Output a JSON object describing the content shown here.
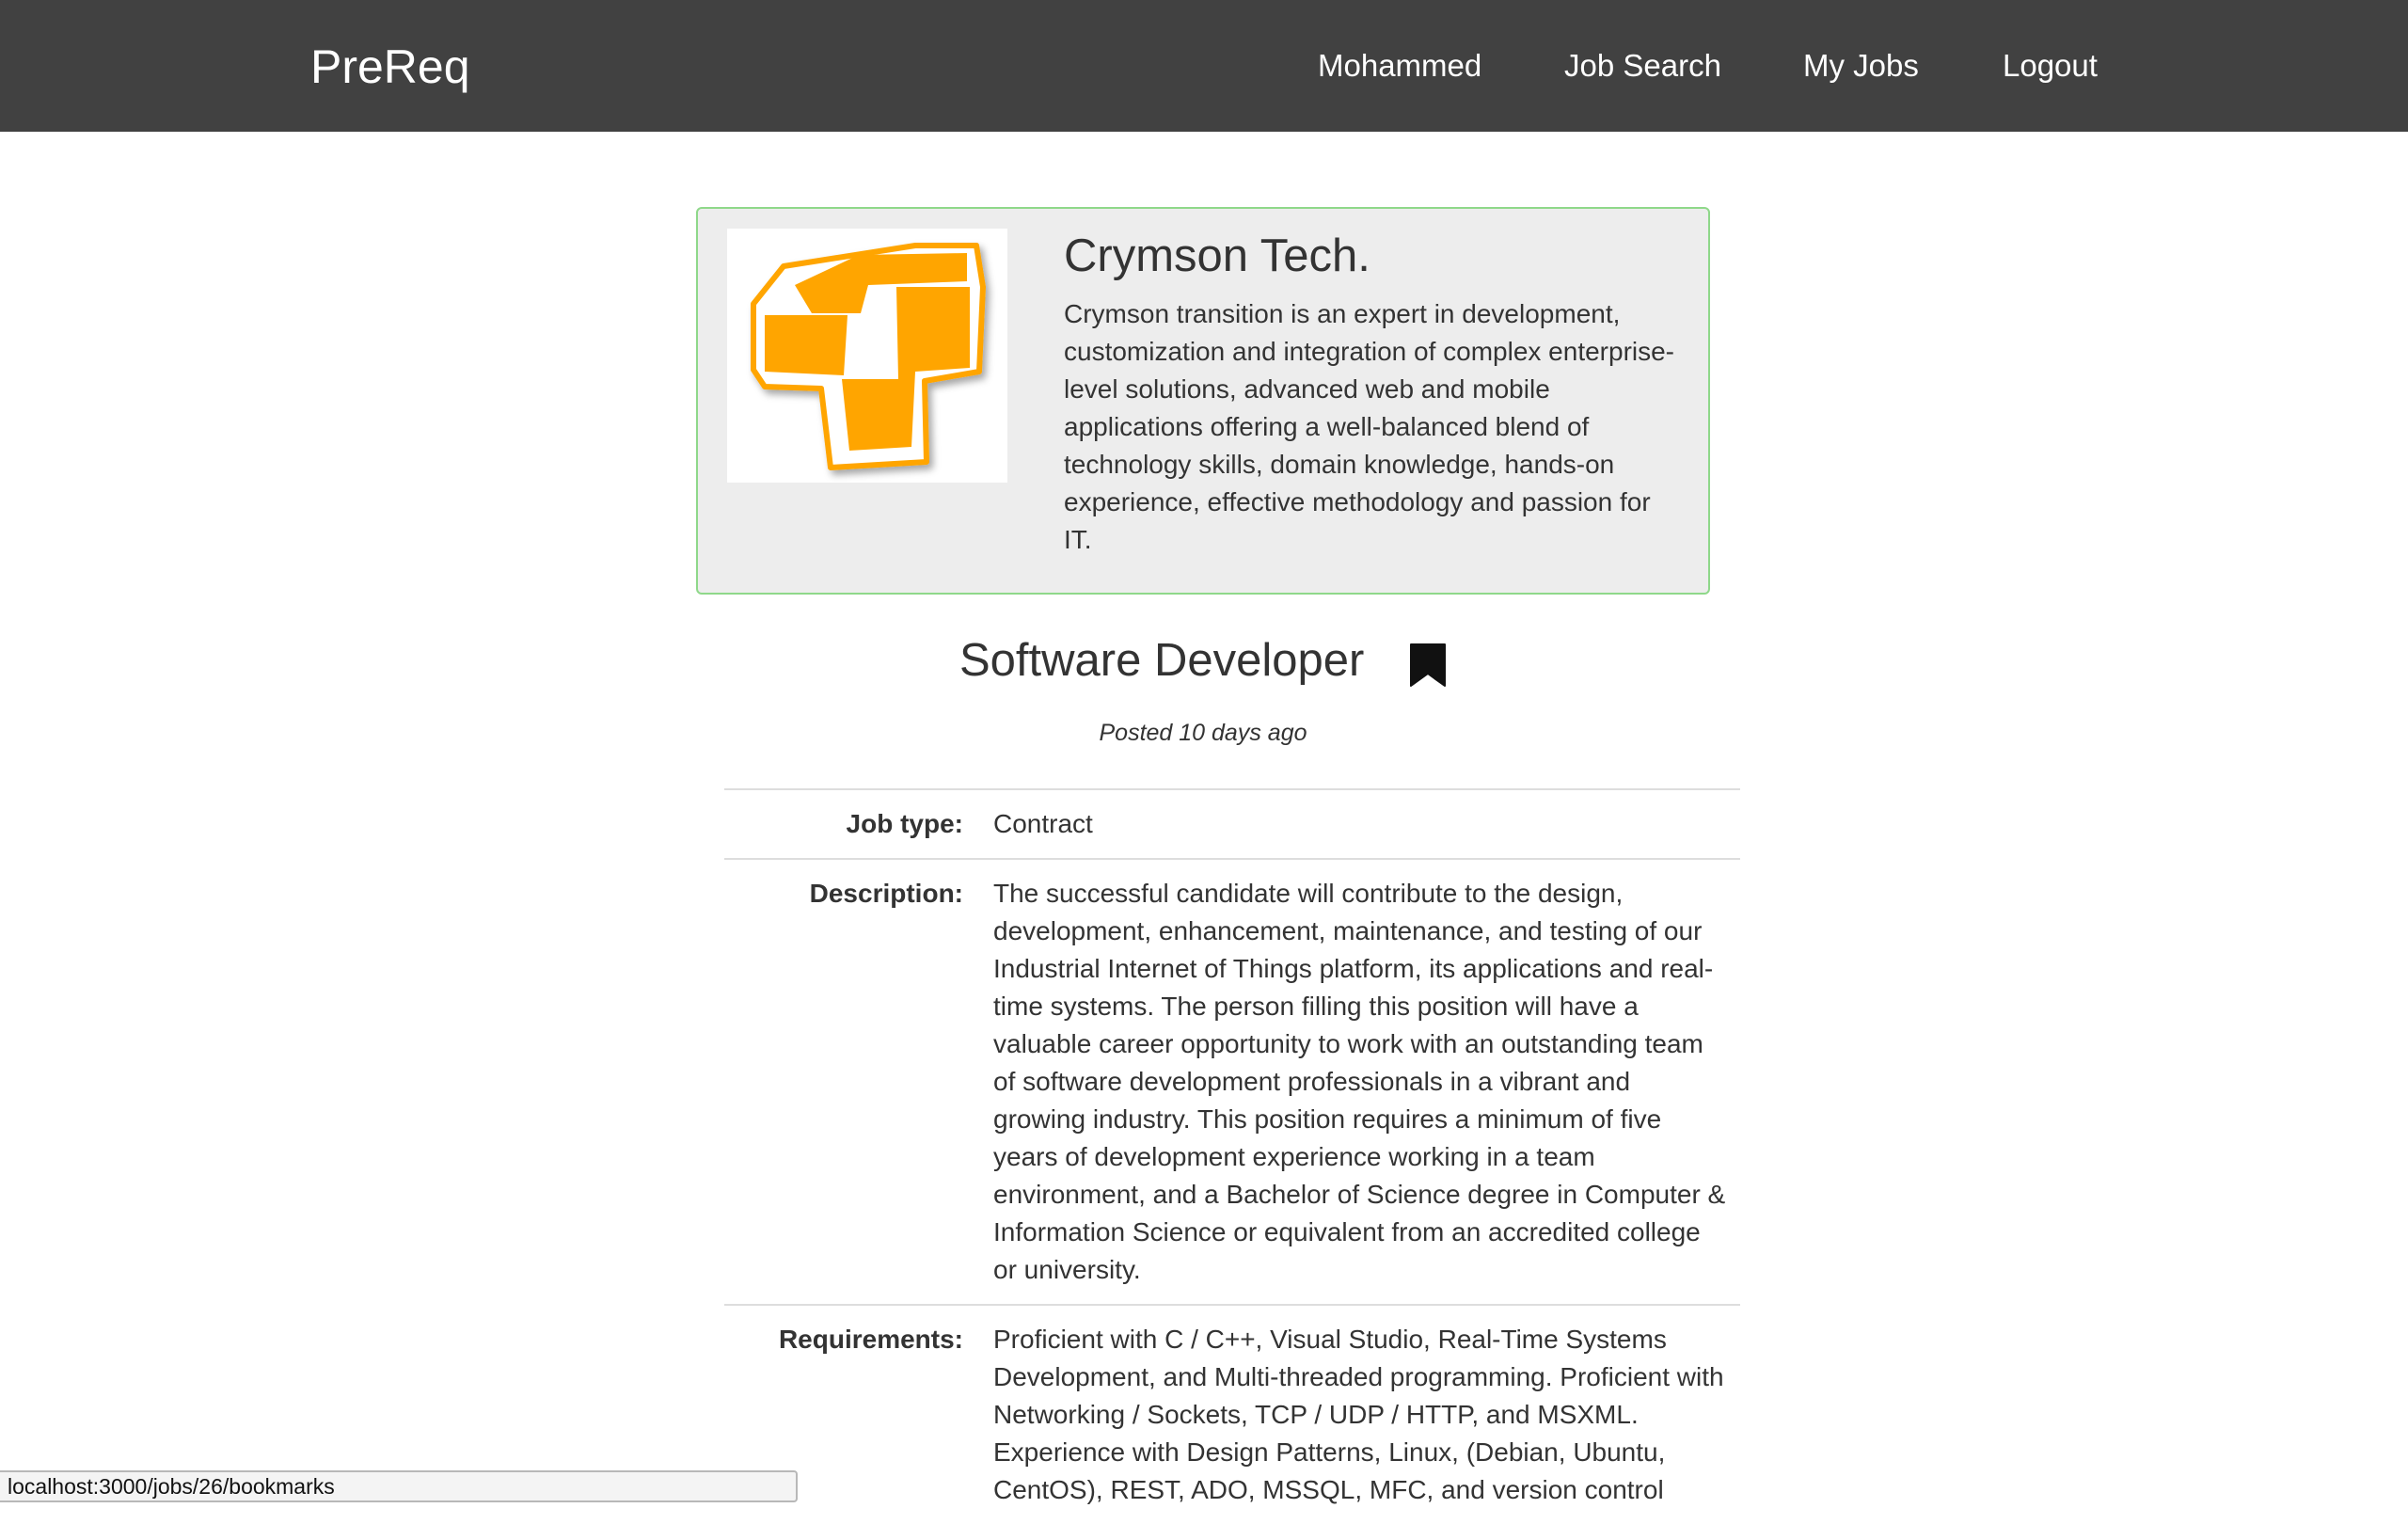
{
  "navbar": {
    "brand": "PreReq",
    "links": [
      {
        "label": "Mohammed"
      },
      {
        "label": "Job Search"
      },
      {
        "label": "My Jobs"
      },
      {
        "label": "Logout"
      }
    ]
  },
  "company": {
    "name": "Crymson Tech.",
    "description": "Crymson transition is an expert in development, customization and integration of complex enterprise-level solutions, advanced web and mobile applications offering a well-balanced blend of technology skills, domain knowledge, hands-on experience, effective methodology and passion for IT.",
    "logo_icon": "crymson-logo",
    "logo_color": "#ffa500",
    "card_border_color": "#8fd88a"
  },
  "job": {
    "title": "Software Developer",
    "bookmark_icon": "bookmark-icon",
    "posted": "Posted 10 days ago",
    "details": [
      {
        "label": "Job type:",
        "value": "Contract"
      },
      {
        "label": "Description:",
        "value": "The successful candidate will contribute to the design, development, enhancement, maintenance, and testing of our Industrial Internet of Things platform, its applications and real-time systems. The person filling this position will have a valuable career opportunity to work with an outstanding team of software development professionals in a vibrant and growing industry. This position requires a minimum of five years of development experience working in a team environment, and a Bachelor of Science degree in Computer & Information Science or equivalent from an accredited college or university."
      },
      {
        "label": "Requirements:",
        "value": "Proficient with C / C++, Visual Studio, Real-Time Systems Development, and Multi-threaded programming. Proficient with Networking / Sockets, TCP / UDP / HTTP, and MSXML. Experience with Design Patterns, Linux, (Debian, Ubuntu, CentOS), REST, ADO, MSSQL, MFC, and version control"
      }
    ]
  },
  "statusbar": {
    "url": "localhost:3000/jobs/26/bookmarks"
  }
}
